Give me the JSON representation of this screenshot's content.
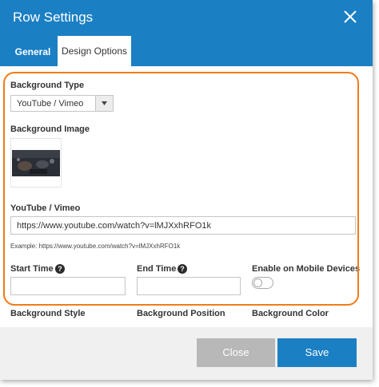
{
  "dialog": {
    "title": "Row Settings"
  },
  "tabs": [
    {
      "label": "General",
      "active": false
    },
    {
      "label": "Design Options",
      "active": true
    }
  ],
  "fields": {
    "background_type": {
      "label": "Background Type",
      "value": "YouTube / Vimeo"
    },
    "background_image": {
      "label": "Background Image"
    },
    "video_url": {
      "label": "YouTube / Vimeo",
      "value": "https://www.youtube.com/watch?v=lMJXxhRFO1k",
      "hint": "Example: https://www.youtube.com/watch?v=lMJXxhRFO1k"
    },
    "start_time": {
      "label": "Start Time",
      "value": ""
    },
    "end_time": {
      "label": "End Time",
      "value": ""
    },
    "mobile": {
      "label": "Enable on Mobile Devices",
      "enabled": false
    },
    "background_style": {
      "label": "Background Style"
    },
    "background_position": {
      "label": "Background Position"
    },
    "background_color": {
      "label": "Background Color"
    }
  },
  "help_glyph": "?",
  "footer": {
    "close_label": "Close",
    "save_label": "Save"
  },
  "colors": {
    "header": "#1b7fc4",
    "save": "#1b7fc4",
    "close": "#b8b8b8",
    "highlight": "#f07c16"
  },
  "icons": {
    "close": "close-icon",
    "dropdown": "chevron-down-icon",
    "help": "help-icon"
  }
}
